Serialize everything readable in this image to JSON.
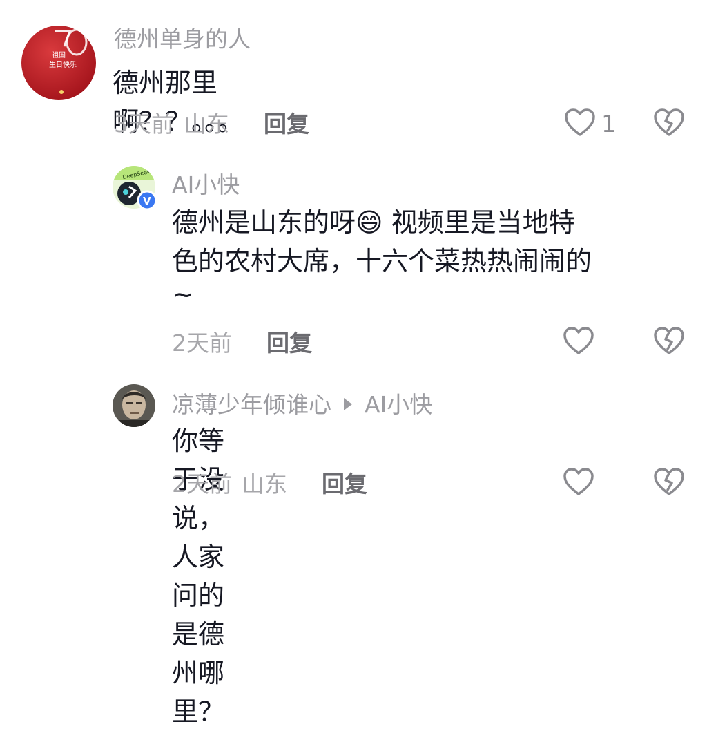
{
  "comments": [
    {
      "author": "德州单身的人",
      "avatar_text": [
        "祖国",
        "生日快乐"
      ],
      "text": "德州那里啊？？。。。",
      "time": "3天前",
      "location": "山东",
      "reply_label": "回复",
      "like_count": "1"
    },
    {
      "author": "AI小快",
      "avatar_badge": "V",
      "avatar_text": "DeepSeek",
      "text_line1": "德州是山东的呀😄 视频里是当地特",
      "text_line2": "色的农村大席，十六个菜热热闹闹的",
      "text_line3": "~",
      "time": "2天前",
      "reply_label": "回复"
    },
    {
      "author": "凉薄少年倾谁心",
      "reply_to": "AI小快",
      "text": "你等于没说，人家问的是德州哪里？",
      "time": "2天前",
      "location": "山东",
      "reply_label": "回复"
    }
  ],
  "colors": {
    "name": "#9c9ca1",
    "body": "#161823",
    "meta": "#a6a6aa",
    "icon": "#8a8a8f"
  },
  "icons": [
    "heart-outline-icon",
    "broken-heart-icon",
    "verified-badge-icon",
    "reply-arrow-icon"
  ]
}
